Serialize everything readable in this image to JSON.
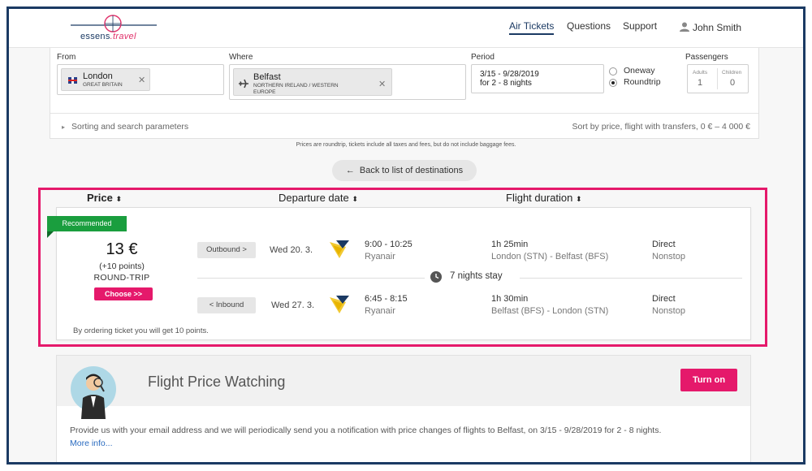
{
  "header": {
    "logo": {
      "name": "essens",
      "suffix": ".travel"
    },
    "nav": [
      {
        "label": "Air Tickets",
        "active": true
      },
      {
        "label": "Questions"
      },
      {
        "label": "Support"
      }
    ],
    "user": {
      "name": "John Smith",
      "icon": "user-icon"
    }
  },
  "search": {
    "from": {
      "label": "From",
      "city": "London",
      "country": "GREAT BRITAIN",
      "flag": "uk-flag-icon"
    },
    "where": {
      "label": "Where",
      "city": "Belfast",
      "region": "NORTHERN IRELAND / WESTERN EUROPE",
      "icon": "plane-icon"
    },
    "period": {
      "label": "Period",
      "dates": "3/15 - 9/28/2019",
      "nights": "for 2 - 8 nights"
    },
    "trip_type": {
      "oneway": "Oneway",
      "roundtrip": "Roundtrip",
      "selected": "Roundtrip"
    },
    "passengers": {
      "label": "Passengers",
      "adults_label": "Adults",
      "adults": "1",
      "children_label": "Children",
      "children": "0"
    },
    "sorting_toggle": "Sorting and search parameters",
    "sort_summary": "Sort by price, flight with transfers, 0 € – 4 000 €"
  },
  "note": "Prices are roundtrip, tickets include all taxes and fees, but do not include baggage fees.",
  "back_button": "Back to list of destinations",
  "sort_headers": {
    "price": "Price",
    "departure": "Departure date",
    "duration": "Flight duration"
  },
  "result": {
    "badge": "Recommended",
    "price": "13 €",
    "points": "(+10 points)",
    "trip": "ROUND-TRIP",
    "choose": "Choose >>",
    "outbound": {
      "tag": "Outbound >",
      "date": "Wed 20. 3.",
      "time": "9:00 - 10:25",
      "airline": "Ryanair",
      "duration": "1h 25min",
      "route": "London (STN) - Belfast (BFS)",
      "type": "Direct",
      "stops": "Nonstop"
    },
    "stay": "7 nights stay",
    "inbound": {
      "tag": "< Inbound",
      "date": "Wed 27. 3.",
      "time": "6:45 - 8:15",
      "airline": "Ryanair",
      "duration": "1h 30min",
      "route": "Belfast (BFS) - London (STN)",
      "type": "Direct",
      "stops": "Nonstop"
    },
    "ordering_note": "By ordering ticket you will get 10 points."
  },
  "watching": {
    "title": "Flight Price Watching",
    "button": "Turn on",
    "description": "Provide us with your email address and we will periodically send you a notification with price changes of flights to Belfast, on 3/15 - 9/28/2019 for 2 - 8 nights.",
    "more": "More info..."
  },
  "colors": {
    "brand_pink": "#e5196b",
    "navy": "#1b3a63",
    "recommended_green": "#1a9e3e",
    "ryanair_yellow": "#f1c933"
  }
}
